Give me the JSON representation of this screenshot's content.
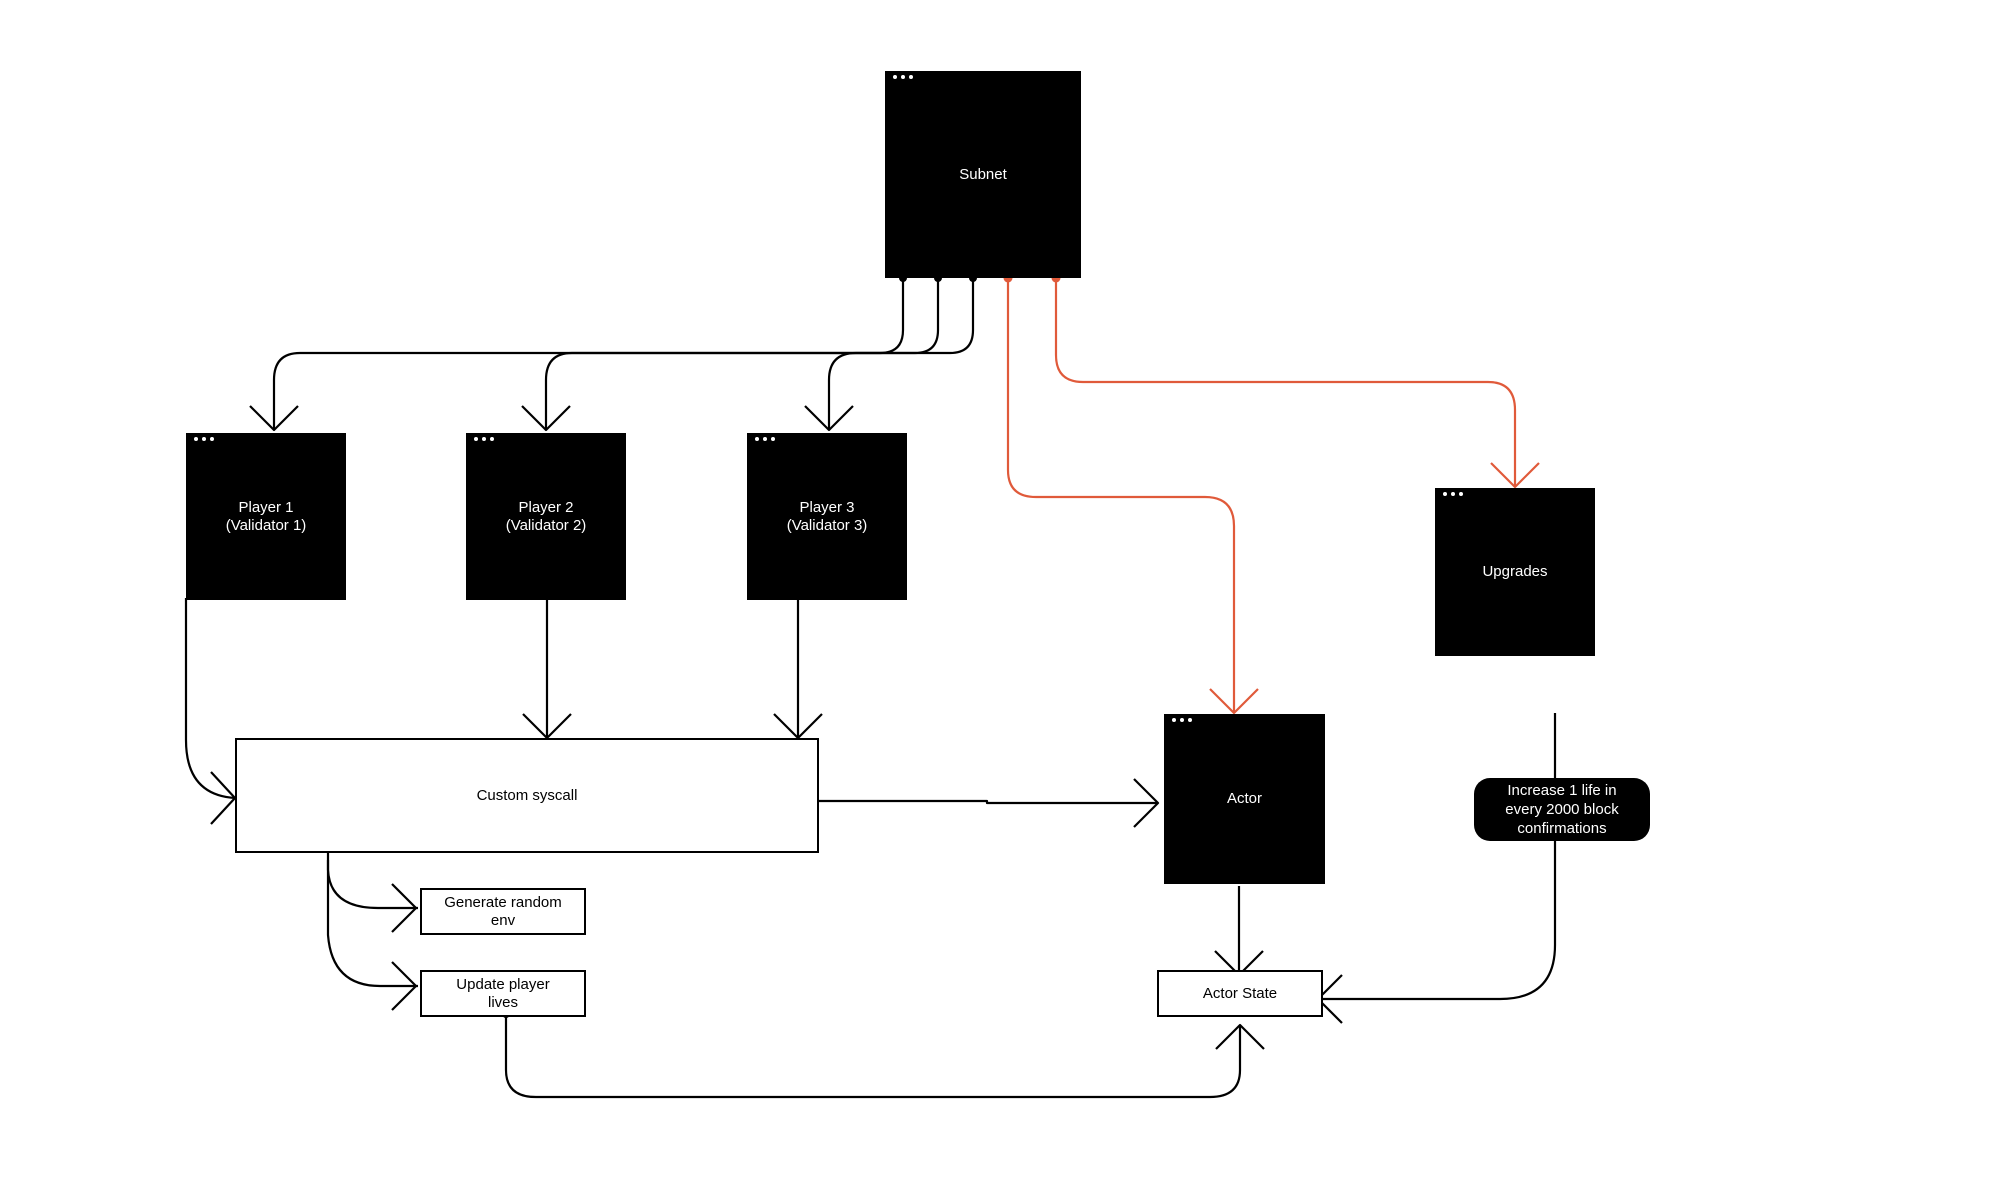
{
  "colors": {
    "node_fill": "#000000",
    "node_text": "#ffffff",
    "wire_black": "#000000",
    "wire_orange": "#E05A3A"
  },
  "nodes": {
    "subnet": {
      "label": "Subnet",
      "menu_icon": "ellipsis-icon"
    },
    "player1": {
      "label": "Player 1\n(Validator 1)",
      "menu_icon": "ellipsis-icon"
    },
    "player2": {
      "label": "Player 2\n(Validator 2)",
      "menu_icon": "ellipsis-icon"
    },
    "player3": {
      "label": "Player 3\n(Validator 3)",
      "menu_icon": "ellipsis-icon"
    },
    "upgrades": {
      "label": "Upgrades",
      "menu_icon": "ellipsis-icon"
    },
    "actor": {
      "label": "Actor",
      "menu_icon": "ellipsis-icon"
    },
    "custom_syscall": {
      "label": "Custom syscall"
    },
    "generate_env": {
      "label": "Generate random\nenv"
    },
    "update_lives": {
      "label": "Update player\nlives"
    },
    "actor_state": {
      "label": "Actor State"
    },
    "upgrade_note": {
      "label": "Increase 1 life in\nevery 2000 block\nconfirmations"
    }
  },
  "edges": [
    {
      "from": "subnet",
      "to": "player1",
      "color": "black"
    },
    {
      "from": "subnet",
      "to": "player2",
      "color": "black"
    },
    {
      "from": "subnet",
      "to": "player3",
      "color": "black"
    },
    {
      "from": "subnet",
      "to": "actor",
      "color": "orange"
    },
    {
      "from": "subnet",
      "to": "upgrades",
      "color": "orange"
    },
    {
      "from": "player1",
      "to": "custom_syscall",
      "color": "black"
    },
    {
      "from": "player2",
      "to": "custom_syscall",
      "color": "black"
    },
    {
      "from": "player3",
      "to": "custom_syscall",
      "color": "black"
    },
    {
      "from": "custom_syscall",
      "to": "actor",
      "color": "black"
    },
    {
      "from": "custom_syscall",
      "to": "generate_env",
      "color": "black"
    },
    {
      "from": "custom_syscall",
      "to": "update_lives",
      "color": "black"
    },
    {
      "from": "update_lives",
      "to": "actor_state",
      "color": "black"
    },
    {
      "from": "actor",
      "to": "actor_state",
      "color": "black"
    },
    {
      "from": "upgrades",
      "to": "actor_state",
      "color": "black",
      "label": "upgrade_note"
    }
  ]
}
